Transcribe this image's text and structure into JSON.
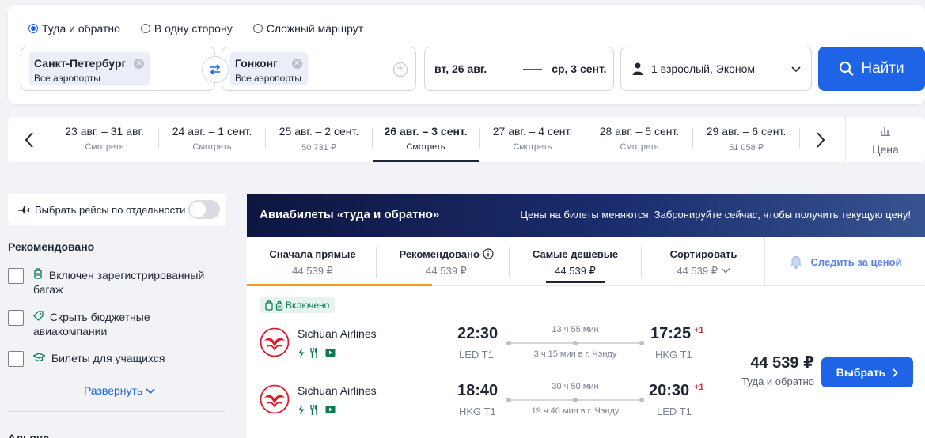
{
  "search": {
    "trip_types": [
      {
        "label": "Туда и обратно",
        "checked": true
      },
      {
        "label": "В одну сторону",
        "checked": false
      },
      {
        "label": "Сложный маршрут",
        "checked": false
      }
    ],
    "from": {
      "city": "Санкт-Петербург",
      "airports": "Все аэропорты"
    },
    "to": {
      "city": "Гонконг",
      "airports": "Все аэропорты"
    },
    "depart_date": "вт, 26 авг.",
    "return_date": "ср, 3 сент.",
    "passengers": "1 взрослый, Эконом",
    "find_label": "Найти"
  },
  "date_strip": [
    {
      "range": "23 авг. – 31 авг.",
      "sub": "Смотреть",
      "active": false
    },
    {
      "range": "24 авг. – 1 сент.",
      "sub": "Смотреть",
      "active": false
    },
    {
      "range": "25 авг. – 2 сент.",
      "sub": "50 731 ₽",
      "active": false
    },
    {
      "range": "26 авг. – 3 сент.",
      "sub": "Смотреть",
      "active": true
    },
    {
      "range": "27 авг. – 4 сент.",
      "sub": "Смотреть",
      "active": false
    },
    {
      "range": "28 авг. – 5 сент.",
      "sub": "Смотреть",
      "active": false
    },
    {
      "range": "29 авг. – 6 сент.",
      "sub": "51 058 ₽",
      "active": false
    }
  ],
  "price_tab_label": "Цена",
  "sidebar": {
    "separate_flights": "Выбрать рейсы по отдельности",
    "recommended_title": "Рекомендовано",
    "filters": [
      {
        "line1": "Включен зарегистрированный",
        "line2": "багаж"
      },
      {
        "line1": "Скрыть бюджетные",
        "line2": "авиакомпании"
      },
      {
        "line1": "Билеты для учащихся",
        "line2": ""
      }
    ],
    "expand_label": "Развернуть",
    "next_section": "Альянс"
  },
  "banner": {
    "title": "Авиабилеты «туда и обратно»",
    "message": "Цены на билеты меняются. Забронируйте сейчас, чтобы получить текущую цену!"
  },
  "sort_tabs": [
    {
      "label": "Сначала прямые",
      "price": "44 539 ₽",
      "active": false
    },
    {
      "label": "Рекомендовано",
      "price": "44 539 ₽",
      "active": false
    },
    {
      "label": "Самые дешевые",
      "price": "44 539 ₽",
      "active": true
    },
    {
      "label": "Сортировать",
      "price": "44 539 ₽",
      "active": false
    }
  ],
  "track_label": "Следить за ценой",
  "result": {
    "baggage_badge": "Включено",
    "legs": [
      {
        "airline": "Sichuan Airlines",
        "dep_time": "22:30",
        "dep_airport": "LED T1",
        "arr_time": "17:25",
        "arr_airport": "HKG T1",
        "day_offset": "+1",
        "duration": "13 ч 55 мин",
        "stop": "3 ч 15 мин в г. Чэнду"
      },
      {
        "airline": "Sichuan Airlines",
        "dep_time": "18:40",
        "dep_airport": "HKG T1",
        "arr_time": "20:30",
        "arr_airport": "LED T1",
        "day_offset": "+1",
        "duration": "30 ч 50 мин",
        "stop": "19 ч 40 мин в г. Чэнду"
      }
    ],
    "price": "44 539 ₽",
    "price_sub": "Туда и обратно",
    "select_label": "Выбрать"
  },
  "colors": {
    "accent": "#1f63e6",
    "banner_bg": "#0d1640",
    "sort_highlight": "#f59a1b",
    "badge_green": "#0d7a55"
  }
}
